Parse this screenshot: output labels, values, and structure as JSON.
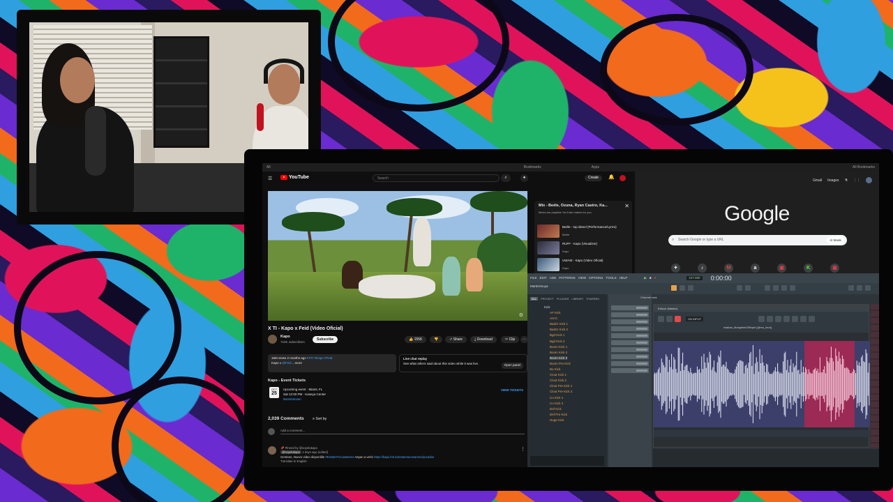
{
  "browser": {
    "tabs_left": [
      "All",
      "Bookmarks"
    ],
    "tabs_right": [
      "Apps",
      "All Bookmarks"
    ]
  },
  "youtube": {
    "search_placeholder": "Search",
    "create_label": "Create",
    "logo_text": "YouTube",
    "video_title": "X TI - Kapo x Feid (Video Oficial)",
    "channel": {
      "name": "Kapo",
      "subs": "715K subscribers",
      "subscribe_label": "Subscribe"
    },
    "actions": {
      "likes": "155K",
      "share": "Share",
      "download": "Download",
      "clip": "Clip"
    },
    "description": {
      "meta": "15M views  2 months ago",
      "hashtags": "#XTI #Kapo #Feid",
      "line2": "Kapo x",
      "feid_link": "@Feid",
      "more": "...more"
    },
    "live_chat": {
      "title": "Live chat replay",
      "text": "See what others said about this video while it was live.",
      "open_label": "Open panel"
    },
    "tickets": {
      "heading": "Kapo - Event Tickets",
      "month": "OCT",
      "day": "25",
      "event_title": "Upcoming event · Miami, FL",
      "event_detail": "Sat 12:00 PM · Kaseya Center",
      "vendor": "Bandsintown",
      "view_label": "VIEW TICKETS"
    },
    "comments": {
      "count": "2,039 Comments",
      "sort_label": "Sort by",
      "add_placeholder": "Add a comment...",
      "pinned": "Pinned by @soyelukapo",
      "author": "@soyelukapo",
      "time": "2 days ago (edited)",
      "text": "Genteee, Nuevo video disponible",
      "tag": "#EstaEsTuCasaNena",
      "text2": "Vayan a verlo",
      "link": "https://kapo.lnk.to/estaestucasanena/youtube",
      "translate": "Translate to English"
    },
    "mix": {
      "title": "Mix - Beéle, Ozuna, Ryan Castro, Ka...",
      "subtitle": "Mixes are playlists YouTube makes for you",
      "items": [
        {
          "title": "Beéle - top diesel (Performance/Lyrics)",
          "artist": "Beéle"
        },
        {
          "title": "RUFF - Kapo (Visualizer)",
          "artist": "Kapo"
        },
        {
          "title": "UWAIE - Kapo (Video Oficial)",
          "artist": "Kapo"
        }
      ]
    }
  },
  "google": {
    "logo": "Google",
    "top_links": [
      "Gmail",
      "Images"
    ],
    "search_placeholder": "Search Google or type a URL",
    "ai_mode_label": "AI Mode",
    "shortcuts": [
      {
        "glyph": "✦",
        "label": "Vote"
      },
      {
        "glyph": "♪",
        "label": "TikTok"
      },
      {
        "glyph": "M",
        "label": "Inbox"
      },
      {
        "glyph": "a",
        "label": "Amazon"
      },
      {
        "glyph": "▣",
        "label": "Roy"
      },
      {
        "glyph": "K",
        "label": "Kick"
      },
      {
        "glyph": "▣",
        "label": "Kick"
      }
    ]
  },
  "fl_studio": {
    "menu": [
      "FILE",
      "EDIT",
      "ADD",
      "PATTERNS",
      "VIEW",
      "OPTIONS",
      "TOOLS",
      "HELP"
    ],
    "bpm": "107.000",
    "time": "0:00:00",
    "project": "MartinOsoya",
    "browser_tabs": [
      "ALL",
      "PROJECT",
      "PLUGINS",
      "LIBRARY",
      "STARRED"
    ],
    "browser_root": "Kick",
    "browser_items": [
      "AF Kick",
      "Ant K",
      "Badzz Kick 1",
      "Badzz Kick 2",
      "Bgd Kick 1",
      "Bgd Kick 2",
      "Boom Kick 1",
      "Boom Kick 2",
      "Boom Kick 3",
      "Boom Pre Kick",
      "Bu Kick",
      "Clout Kick 1",
      "Clout Kick 2",
      "Clout Pre Kick 1",
      "Clout Pre Kick 2",
      "Co Kick 1",
      "Co Kick 2",
      "Def Kick",
      "Def Pre Kick",
      "Huge Kick"
    ],
    "rack_title": "Channel rack",
    "editor_title": "Edison (Master)",
    "editor_file": "maikan_bluegetar108bpm [@mu_leon]",
    "mode": "ON INPUT"
  }
}
